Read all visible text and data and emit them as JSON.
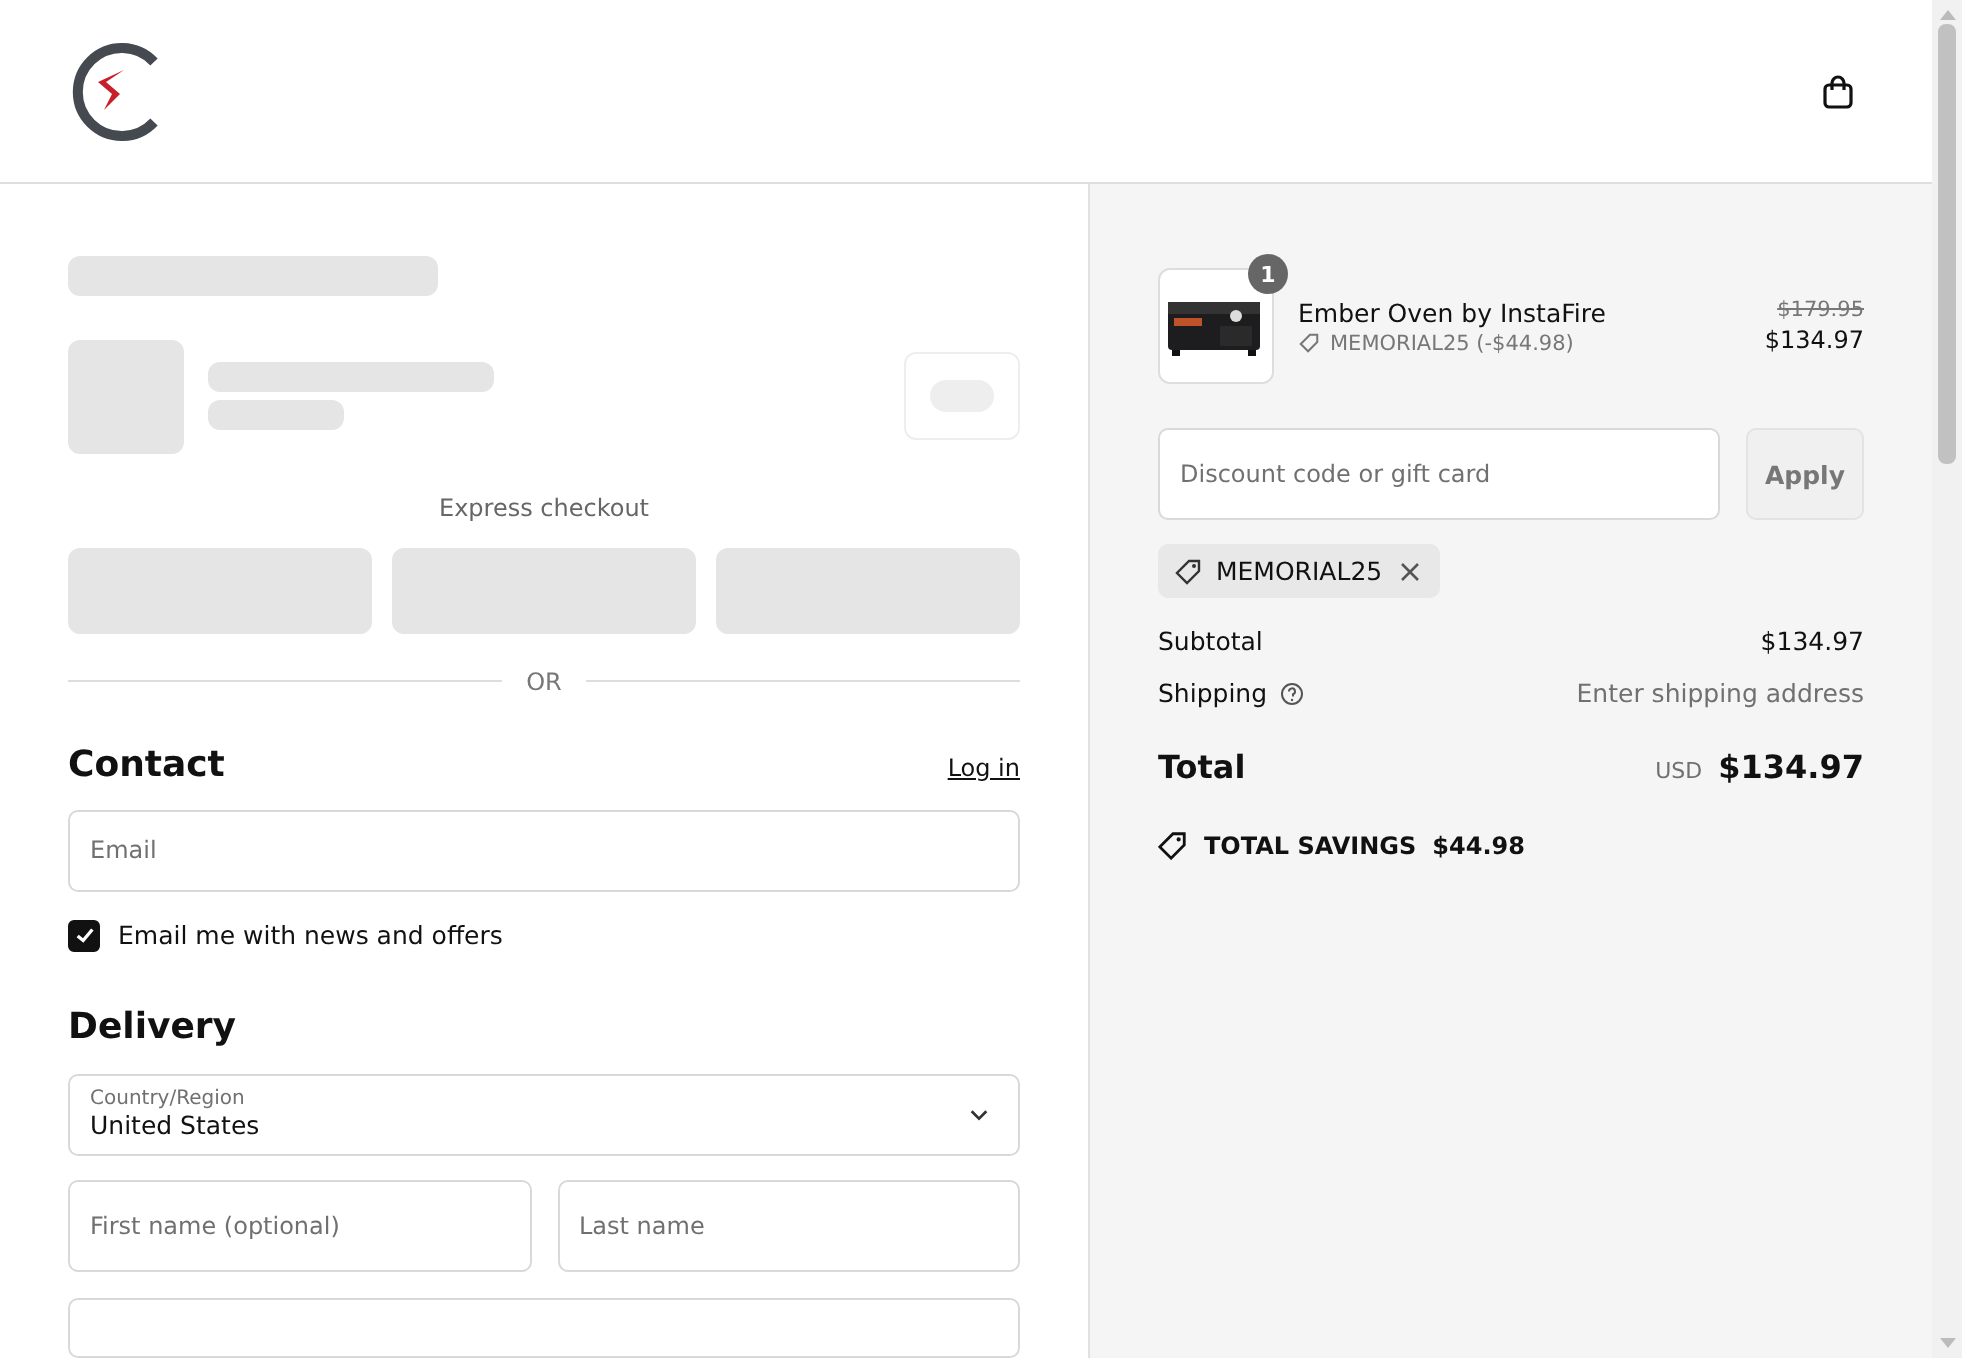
{
  "header": {
    "cart_button": {
      "kind": "bag"
    }
  },
  "express_checkout": {
    "label": "Express checkout",
    "divider": "OR"
  },
  "contact": {
    "heading": "Contact",
    "login_link": "Log in",
    "email": {
      "placeholder": "Email"
    },
    "newsletter": {
      "label": "Email me with news and offers",
      "checked": true
    }
  },
  "delivery": {
    "heading": "Delivery",
    "country": {
      "label": "Country/Region",
      "value": "United States"
    },
    "first_name": {
      "placeholder": "First name (optional)"
    },
    "last_name": {
      "placeholder": "Last name"
    }
  },
  "summary": {
    "item": {
      "quantity": "1",
      "name": "Ember Oven by InstaFire",
      "discount": "MEMORIAL25 (-$44.98)",
      "original_price": "$179.95",
      "price": "$134.97"
    },
    "discount_field": {
      "placeholder": "Discount code or gift card"
    },
    "apply_button": "Apply",
    "applied_code": "MEMORIAL25",
    "subtotal": {
      "label": "Subtotal",
      "value": "$134.97"
    },
    "shipping": {
      "label": "Shipping",
      "value": "Enter shipping address"
    },
    "total": {
      "label": "Total",
      "currency": "USD",
      "value": "$134.97"
    },
    "savings": {
      "label": "TOTAL SAVINGS",
      "value": "$44.98"
    }
  }
}
